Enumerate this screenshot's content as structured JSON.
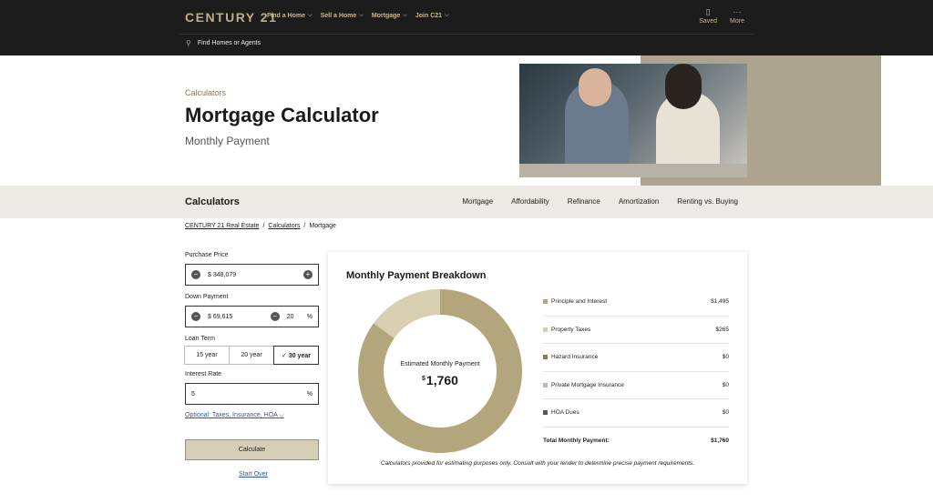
{
  "header": {
    "logo": "CENTURY 21",
    "nav": [
      {
        "label": "Find a Home"
      },
      {
        "label": "Sell a Home"
      },
      {
        "label": "Mortgage"
      },
      {
        "label": "Join C21"
      }
    ],
    "saved_label": "Saved",
    "more_label": "More",
    "search_label": "Find Homes or Agents"
  },
  "hero": {
    "eyebrow": "Calculators",
    "title": "Mortgage Calculator",
    "subtitle": "Monthly Payment"
  },
  "strip": {
    "title": "Calculators",
    "tabs": [
      {
        "label": "Mortgage"
      },
      {
        "label": "Affordability"
      },
      {
        "label": "Refinance"
      },
      {
        "label": "Amortization"
      },
      {
        "label": "Renting vs. Buying"
      }
    ]
  },
  "breadcrumb": {
    "items": [
      "CENTURY 21 Real Estate",
      "Calculators",
      "Mortgage"
    ],
    "separator": "/"
  },
  "form": {
    "purchase_price_label": "Purchase Price",
    "purchase_price_value": "$ 348,079",
    "down_payment_label": "Down Payment",
    "down_payment_value": "$ 69,615",
    "down_payment_percent": "20",
    "percent_sign": "%",
    "loan_term_label": "Loan Term",
    "loan_terms": [
      {
        "label": "15 year",
        "active": false
      },
      {
        "label": "20 year",
        "active": false
      },
      {
        "label": "✓ 30 year",
        "active": true
      }
    ],
    "interest_rate_label": "Interest Rate",
    "interest_rate_value": "5",
    "optional_label": "Optional: Taxes, Insurance, HOA",
    "calculate_label": "Calculate",
    "start_over_label": "Start Over"
  },
  "breakdown": {
    "title": "Monthly Payment Breakdown",
    "estimate_label": "Estimated Monthly Payment",
    "estimate_currency": "$",
    "estimate_value": "1,760",
    "items": [
      {
        "name": "Principle and Interest",
        "amount": "$1,495",
        "color": "#b3a57c"
      },
      {
        "name": "Property Taxes",
        "amount": "$265",
        "color": "#d8ceb0"
      },
      {
        "name": "Hazard Insurance",
        "amount": "$0",
        "color": "#8a7c58"
      },
      {
        "name": "Private Mortgage Insurance",
        "amount": "$0",
        "color": "#b9b9b9"
      },
      {
        "name": "HOA Dues",
        "amount": "$0",
        "color": "#555555"
      }
    ],
    "total_label": "Total Monthly Payment:",
    "total_value": "$1,760",
    "disclaimer": "Calculators provided for estimating purposes only. Consult with your lender to determine precise payment requirements."
  },
  "chart_data": {
    "type": "pie",
    "categories": [
      "Principle and Interest",
      "Property Taxes",
      "Hazard Insurance",
      "Private Mortgage Insurance",
      "HOA Dues"
    ],
    "values": [
      1495,
      265,
      0,
      0,
      0
    ]
  }
}
